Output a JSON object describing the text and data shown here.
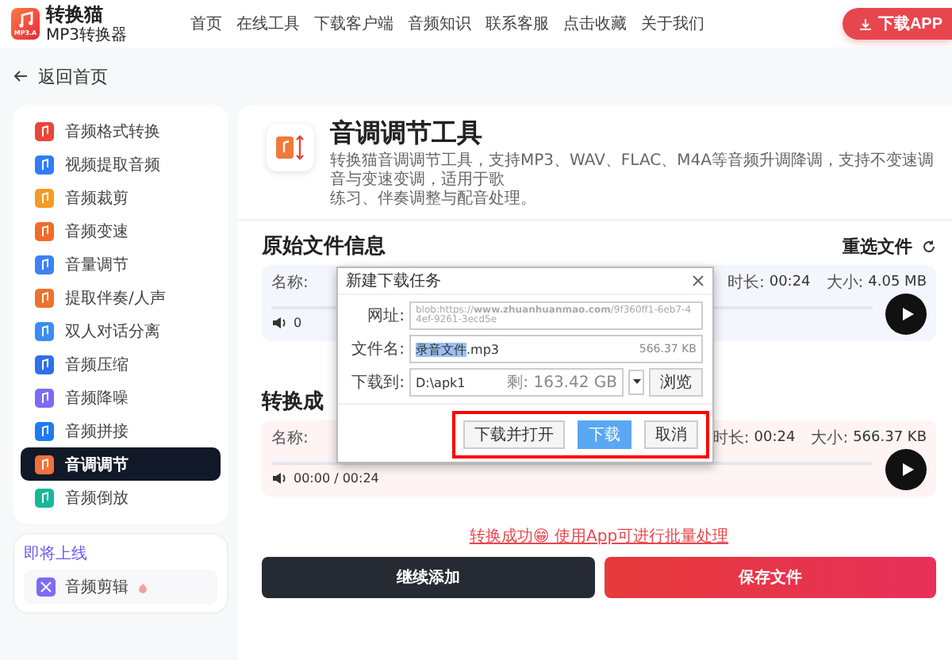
{
  "header": {
    "logo_badge": "MP3.A",
    "brand": "转换猫",
    "subtitle": "MP3转换器",
    "nav": [
      "首页",
      "在线工具",
      "下载客户端",
      "音频知识",
      "联系客服",
      "点击收藏",
      "关于我们"
    ],
    "download_button": "下载APP"
  },
  "back_link": "返回首页",
  "sidebar": {
    "items": [
      {
        "label": "音频格式转换",
        "color": "#e8463c",
        "selected": false
      },
      {
        "label": "视频提取音频",
        "color": "#2f7df6",
        "selected": false
      },
      {
        "label": "音频裁剪",
        "color": "#f59a23",
        "selected": false
      },
      {
        "label": "音频变速",
        "color": "#f26b2b",
        "selected": false
      },
      {
        "label": "音量调节",
        "color": "#3b82f6",
        "selected": false
      },
      {
        "label": "提取伴奏/人声",
        "color": "#f0702e",
        "selected": false
      },
      {
        "label": "双人对话分离",
        "color": "#3a8ef0",
        "selected": false
      },
      {
        "label": "音频压缩",
        "color": "#2f6fe8",
        "selected": false
      },
      {
        "label": "音频降噪",
        "color": "#7b6cf0",
        "selected": false
      },
      {
        "label": "音频拼接",
        "color": "#1e7bf0",
        "selected": false
      },
      {
        "label": "音调调节",
        "color": "#f0703a",
        "selected": true
      },
      {
        "label": "音频倒放",
        "color": "#17b89a",
        "selected": false
      }
    ],
    "upcoming": {
      "title": "即将上线",
      "items": [
        {
          "label": "音频剪辑",
          "color": "#7c6cf2"
        }
      ]
    }
  },
  "tool": {
    "title": "音调调节工具",
    "description_lines": [
      "转换猫音调调节工具，支持MP3、WAV、FLAC、M4A等音频升调降调，支持不变速调音与变速变调，适用于歌",
      "练习、伴奏调整与配音处理。"
    ]
  },
  "original": {
    "title": "原始文件信息",
    "reselect": "重选文件",
    "name_label": "名称:",
    "duration_label": "时长:",
    "duration": "00:24",
    "size_label": "大小:",
    "size": "4.05 MB",
    "reading": "0"
  },
  "result": {
    "title": "转换成",
    "name_label": "名称:",
    "duration_label": "时长:",
    "duration": "00:24",
    "size_label": "大小:",
    "size": "566.37 KB",
    "reading": "00:00 / 00:24"
  },
  "message": "转换成功😁 使用App可进行批量处理",
  "actions": [
    "继续添加",
    "保存文件"
  ],
  "dialog": {
    "title": "新建下载任务",
    "url_label": "网址:",
    "url": "blob:https://**www.zhuanhuanmao.com**/9f360ff1-6eb7-44ef-9261-3ecd5e",
    "filename_label": "文件名:",
    "filename_selected": "录音文件",
    "filename_rest": ".mp3",
    "filesize": "566.37 KB",
    "target_label": "下载到:",
    "target": "D:\\apk1",
    "free_space": "剩: 163.42 GB",
    "browse": "浏览",
    "buttons": [
      {
        "label": "下载并打开",
        "selected": false
      },
      {
        "label": "下载",
        "selected": true
      },
      {
        "label": "取消",
        "selected": false
      }
    ]
  }
}
